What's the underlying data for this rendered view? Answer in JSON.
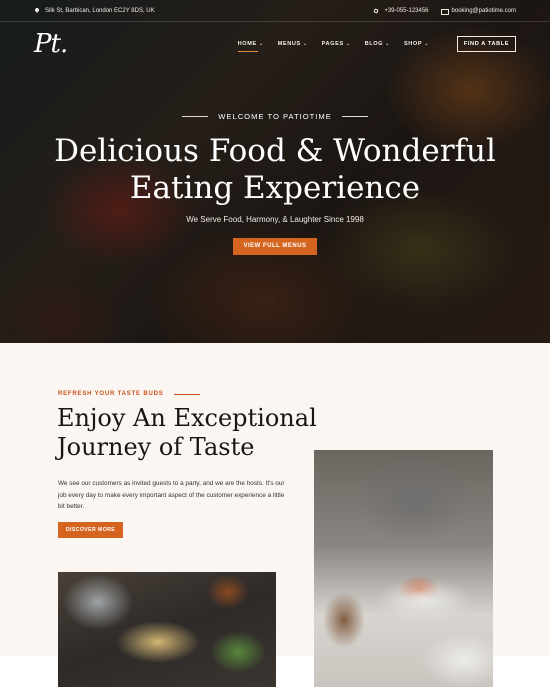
{
  "topbar": {
    "address": "Silk St, Barbican, London EC2Y 8DS, UK",
    "phone": "+39-055-123456",
    "email": "booking@patiotime.com"
  },
  "nav": {
    "logo": "Pt.",
    "items": [
      {
        "label": "HOME",
        "caret": "⌄"
      },
      {
        "label": "MENUS",
        "caret": "⌄"
      },
      {
        "label": "PAGES",
        "caret": "⌄"
      },
      {
        "label": "BLOG",
        "caret": "⌄"
      },
      {
        "label": "SHOP",
        "caret": "⌄"
      }
    ],
    "cta": "FIND A TABLE"
  },
  "hero": {
    "welcome": "WELCOME TO PATIOTIME",
    "title_line1": "Delicious Food & Wonderful",
    "title_line2": "Eating Experience",
    "subtitle": "We Serve Food, Harmony, & Laughter Since 1998",
    "button": "VIEW FULL MENUS"
  },
  "about": {
    "eyebrow": "REFRESH YOUR TASTE BUDS",
    "title_line1": "Enjoy An Exceptional",
    "title_line2": "Journey of Taste",
    "text": "We see our customers as invited guests to a party, and we are the hosts. It's our job every day to make every important aspect of the customer experience a little bit better.",
    "button": "DISCOVER MORE"
  },
  "colors": {
    "accent": "#d5641f",
    "background": "#fbf6f2",
    "heading": "#171717"
  }
}
